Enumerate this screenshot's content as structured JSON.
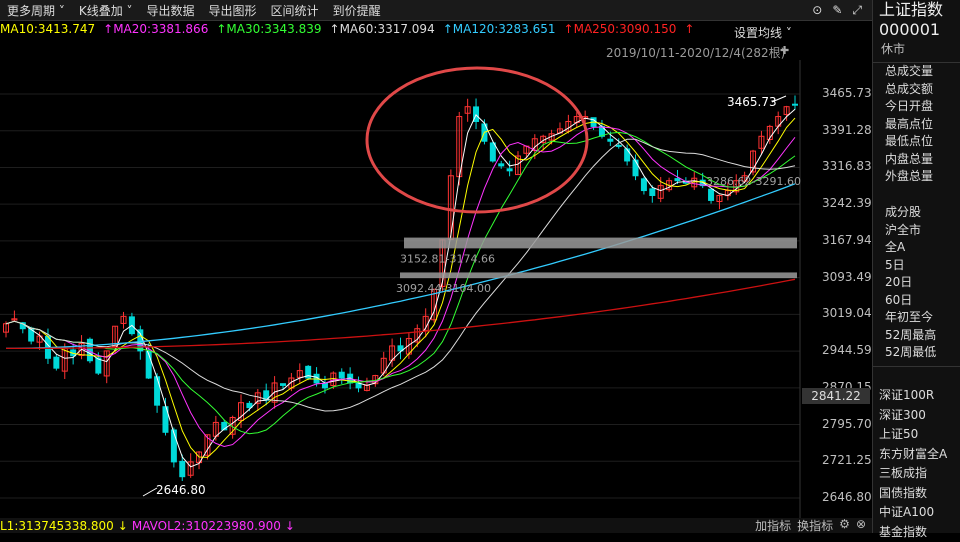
{
  "toolbar": {
    "items": [
      "更多周期",
      "K线叠加",
      "导出数据",
      "导出图形",
      "区间统计",
      "到价提醒"
    ],
    "chevron": "˅"
  },
  "ma_legend": [
    {
      "label": "MA10:3413.747",
      "color": "#ffff00"
    },
    {
      "label": "↑MA20:3381.866",
      "color": "#ff33ff"
    },
    {
      "label": "↑MA30:3343.839",
      "color": "#33ff33"
    },
    {
      "label": "↑MA60:3317.094",
      "color": "#dcdcdc"
    },
    {
      "label": "↑MA120:3283.651",
      "color": "#33ccff"
    },
    {
      "label": "↑MA250:3090.150",
      "color": "#ff2222"
    },
    {
      "label": "↑",
      "color": "#ff2222"
    }
  ],
  "set_ma_label": "设置均线 ˅",
  "date_range": "2019/10/11-2020/12/4(282根)",
  "price_axis": [
    "3465.73",
    "3391.28",
    "3316.83",
    "3242.39",
    "3167.94",
    "3093.49",
    "3019.04",
    "2944.59",
    "2870.15",
    "2795.70",
    "2721.25",
    "2646.80"
  ],
  "current_price": "2841.22",
  "annotations": {
    "high": "3465.73",
    "low": "2646.80",
    "band1": "3152.81-3174.66",
    "band2": "3092.44-3104.00",
    "band3": "3286.62-3291.60"
  },
  "volume_legend": [
    {
      "label": "L1:313745338.800",
      "color": "#ffff00"
    },
    {
      "label": "↓",
      "color": "#ffff00"
    },
    {
      "label": "MAVOL2:310223980.900",
      "color": "#ff33ff"
    },
    {
      "label": "↓",
      "color": "#ff33ff"
    }
  ],
  "bottom_controls": [
    "加指标",
    "换指标",
    "⚙",
    "⊗"
  ],
  "sidebar": {
    "title": "上证指数",
    "code": "000001",
    "status": "休市",
    "stats": [
      "总成交量",
      "总成交额",
      "今日开盘",
      "最高点位",
      "最低点位",
      "内盘总量",
      "外盘总量"
    ],
    "group": [
      "成分股",
      "沪全市",
      "全A",
      "5日",
      "20日",
      "60日",
      "年初至今",
      "52周最高",
      "52周最低"
    ],
    "indices": [
      "深证100R",
      "深证300",
      "上证50",
      "东方财富全A",
      "三板成指",
      "国债指数",
      "中证A100",
      "基金指数"
    ]
  },
  "colors": {
    "up": "#ff3333",
    "down": "#00d9d9",
    "ma5": "#ffffff",
    "ma10": "#ffff00",
    "ma20": "#ff33ff",
    "ma30": "#33ff33",
    "ma60": "#dcdcdc",
    "ma120": "#33ccff",
    "ma250": "#cc1111",
    "circle": "#e04848"
  },
  "chart_data": {
    "type": "candlestick",
    "ylim": [
      2646.8,
      3465.73
    ],
    "y_ticks": [
      3465.73,
      3391.28,
      3316.83,
      3242.39,
      3167.94,
      3093.49,
      3019.04,
      2944.59,
      2870.15,
      2795.7,
      2721.25,
      2646.8
    ],
    "close_series": [
      3000,
      3010,
      2990,
      2965,
      2975,
      2930,
      2910,
      2950,
      2935,
      2960,
      2925,
      2900,
      2945,
      2995,
      3015,
      2980,
      2945,
      2890,
      2835,
      2780,
      2720,
      2690,
      2720,
      2740,
      2775,
      2800,
      2785,
      2810,
      2840,
      2830,
      2860,
      2845,
      2880,
      2875,
      2890,
      2905,
      2890,
      2880,
      2870,
      2900,
      2890,
      2880,
      2870,
      2875,
      2895,
      2930,
      2955,
      2945,
      2970,
      2990,
      3015,
      3070,
      3170,
      3300,
      3420,
      3440,
      3410,
      3370,
      3330,
      3320,
      3310,
      3340,
      3360,
      3375,
      3380,
      3385,
      3395,
      3410,
      3420,
      3420,
      3400,
      3380,
      3370,
      3360,
      3330,
      3300,
      3270,
      3260,
      3280,
      3290,
      3290,
      3285,
      3295,
      3280,
      3250,
      3260,
      3270,
      3290,
      3300,
      3350,
      3380,
      3400,
      3420,
      3440,
      3444
    ],
    "ma_series": {
      "MA120": {
        "start": 2950,
        "end": 3283.651
      },
      "MA250": {
        "start": 2950,
        "end": 3090.15
      }
    }
  }
}
